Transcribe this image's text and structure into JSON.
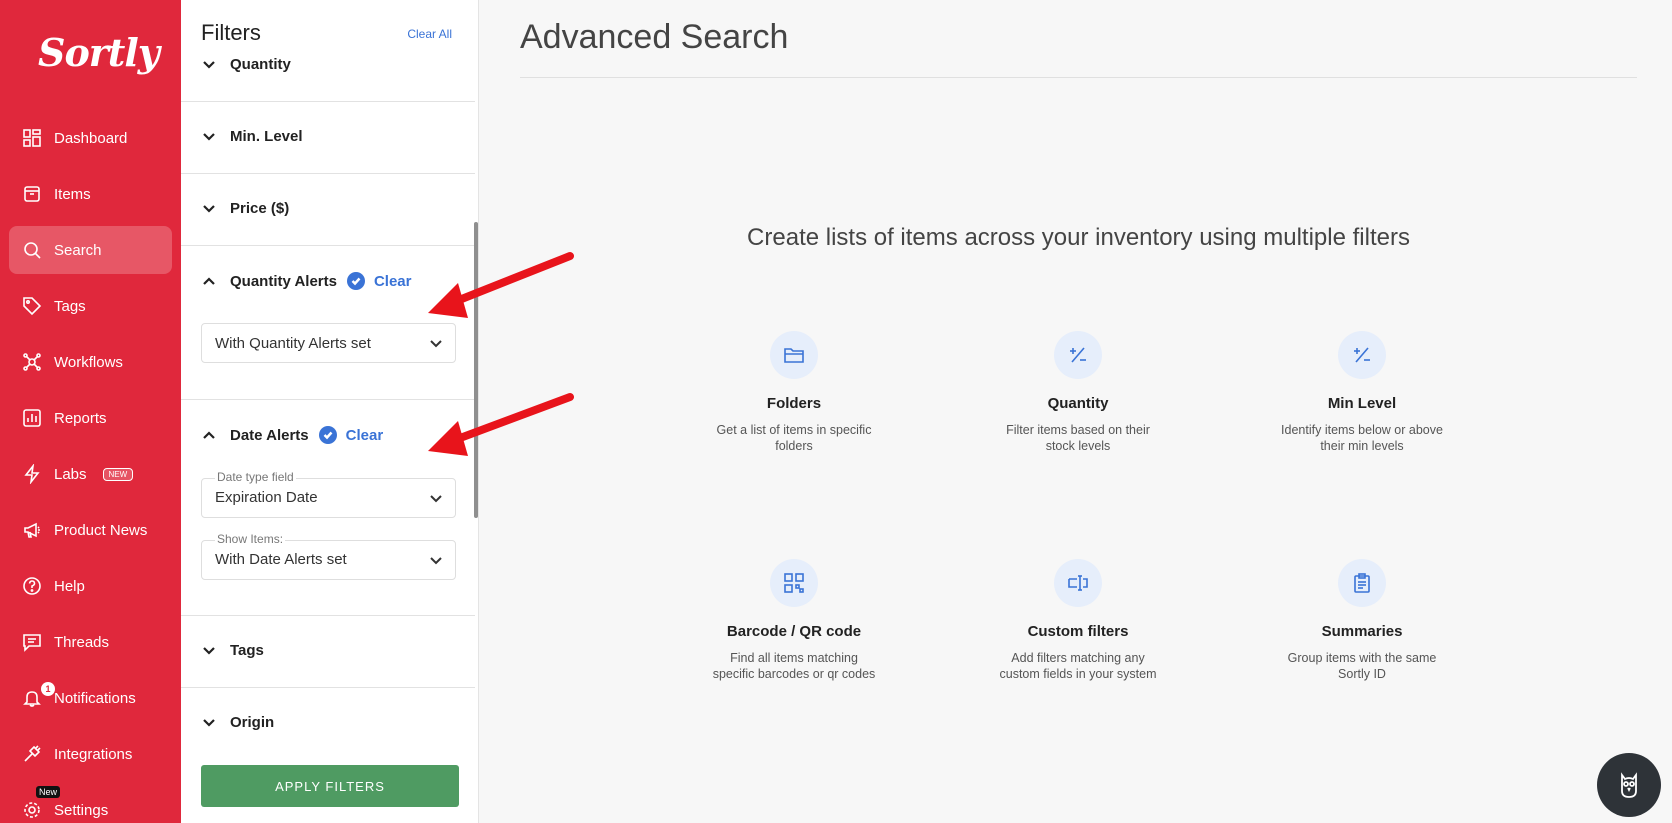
{
  "brand": {
    "logo": "Sortly",
    "color": "#e0283c"
  },
  "sidebar": {
    "items": [
      {
        "label": "Dashboard",
        "icon": "dashboard-icon"
      },
      {
        "label": "Items",
        "icon": "box-icon"
      },
      {
        "label": "Search",
        "icon": "search-icon",
        "active": true
      },
      {
        "label": "Tags",
        "icon": "tag-icon"
      },
      {
        "label": "Workflows",
        "icon": "workflow-icon"
      },
      {
        "label": "Reports",
        "icon": "reports-icon"
      },
      {
        "label": "Labs",
        "icon": "bolt-icon",
        "badge": "NEW"
      },
      {
        "label": "Product News",
        "icon": "megaphone-icon"
      },
      {
        "label": "Help",
        "icon": "help-icon"
      },
      {
        "label": "Threads",
        "icon": "chat-icon"
      },
      {
        "label": "Notifications",
        "icon": "bell-icon",
        "count": "1"
      },
      {
        "label": "Integrations",
        "icon": "plug-icon"
      },
      {
        "label": "Settings",
        "icon": "gear-icon",
        "tag": "New"
      }
    ]
  },
  "filters": {
    "title": "Filters",
    "clear_all": "Clear All",
    "sections": {
      "quantity": "Quantity",
      "min_level": "Min. Level",
      "price": "Price ($)",
      "quantity_alerts": "Quantity Alerts",
      "date_alerts": "Date Alerts",
      "tags": "Tags",
      "origin": "Origin"
    },
    "clear_label": "Clear",
    "quantity_alerts_select": "With Quantity Alerts set",
    "date_type_label": "Date type field",
    "date_type_value": "Expiration Date",
    "show_items_label": "Show Items:",
    "show_items_value": "With Date Alerts set",
    "apply_button": "APPLY FILTERS"
  },
  "main": {
    "title": "Advanced Search",
    "subtitle": "Create lists of items across your inventory using multiple filters",
    "cards": [
      {
        "title": "Folders",
        "desc": "Get a list of items in specific folders",
        "icon": "folder-icon"
      },
      {
        "title": "Quantity",
        "desc": "Filter items based on their stock levels",
        "icon": "plus-minus-icon"
      },
      {
        "title": "Min Level",
        "desc": "Identify items below or above their min levels",
        "icon": "plus-minus-icon"
      },
      {
        "title": "Barcode / QR code",
        "desc": "Find all items matching specific barcodes or qr codes",
        "icon": "qr-code-icon"
      },
      {
        "title": "Custom filters",
        "desc": "Add filters matching any custom fields in your system",
        "icon": "custom-field-icon"
      },
      {
        "title": "Summaries",
        "desc": "Group items with the same Sortly ID",
        "icon": "clipboard-icon"
      }
    ]
  },
  "colors": {
    "accent": "#3a73d6",
    "apply": "#4f9b62",
    "annotation_arrow": "#e8141b"
  }
}
